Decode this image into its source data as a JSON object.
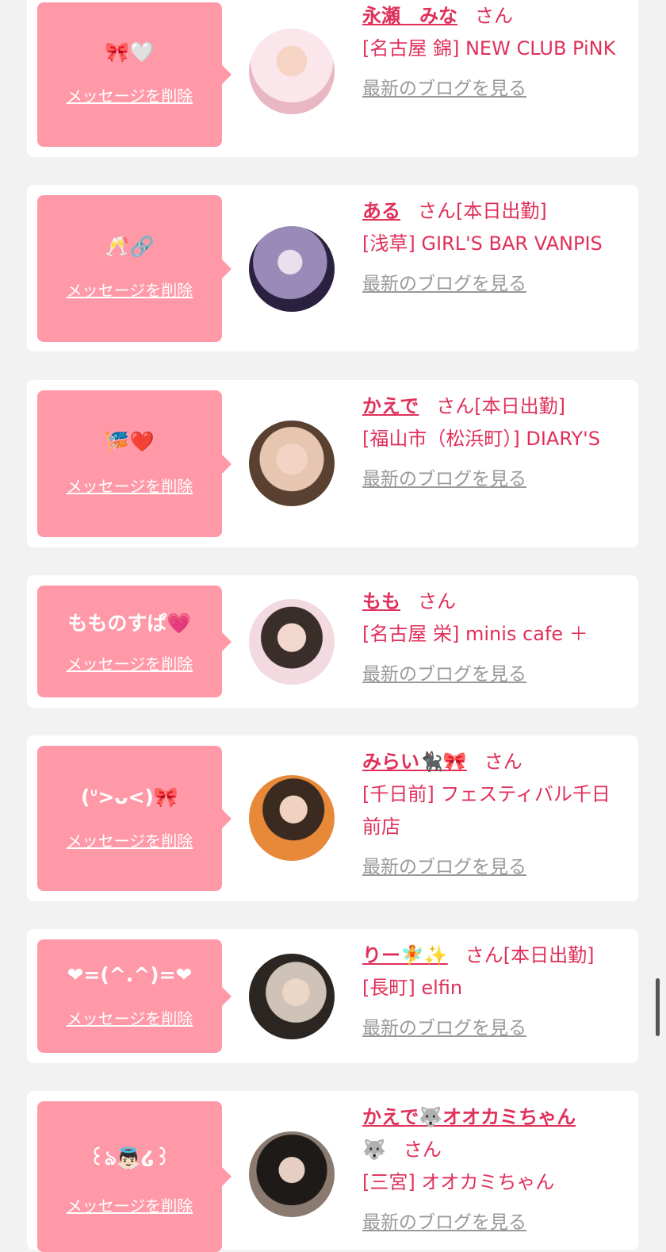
{
  "cards": [
    {
      "message": "🎀🤍",
      "delete_label": "メッセージを削除",
      "name": "永瀬　みな",
      "honorific": "さん",
      "status": "",
      "shop": "[名古屋 錦] NEW CLUB PiNK",
      "blog_link": "最新のブログを見る",
      "avatar_colors": [
        "#fbe6ec",
        "#e8b7c3"
      ]
    },
    {
      "message": "🥂🔗",
      "delete_label": "メッセージを削除",
      "name": "ある",
      "honorific": "さん",
      "status": "[本日出勤]",
      "shop": "[浅草] GIRL'S BAR VANPIS",
      "blog_link": "最新のブログを見る",
      "avatar_colors": [
        "#9a8ab8",
        "#2a2040"
      ]
    },
    {
      "message": "🎏❤️",
      "delete_label": "メッセージを削除",
      "name": "かえで",
      "honorific": "さん",
      "status": "[本日出勤]",
      "shop": "[福山市（松浜町）] DIARY'S",
      "blog_link": "最新のブログを見る",
      "avatar_colors": [
        "#e6c6b0",
        "#5a4030"
      ]
    },
    {
      "message": "もものすぱ💗",
      "delete_label": "メッセージを削除",
      "name": "もも",
      "honorific": "さん",
      "status": "",
      "shop": "[名古屋 栄] minis cafe ＋",
      "blog_link": "最新のブログを見る",
      "avatar_colors": [
        "#f3d9e0",
        "#3a2e2a"
      ]
    },
    {
      "message": "(ᐡ>ᴗ<)🎀",
      "delete_label": "メッセージを削除",
      "name": "みらい🐈‍⬛🎀",
      "honorific": "さん",
      "status": "",
      "shop": "[千日前] フェスティバル千日前店",
      "blog_link": "最新のブログを見る",
      "avatar_colors": [
        "#e8893a",
        "#3a2a20"
      ]
    },
    {
      "message": "❤=(^.^)=❤",
      "delete_label": "メッセージを削除",
      "name": "りー🧚✨",
      "honorific": "さん",
      "status": "[本日出勤]",
      "shop": "[長町] elfin",
      "blog_link": "最新のブログを見る",
      "avatar_colors": [
        "#cfc3b8",
        "#2c2622"
      ]
    },
    {
      "message": "꒰ঌ👼🏻໒꒱",
      "delete_label": "メッセージを削除",
      "name": "かえで🐺オオカミちゃん",
      "name_extra": "🐺",
      "honorific": "さん",
      "status": "",
      "shop": "[三宮] オオカミちゃん",
      "blog_link": "最新のブログを見る",
      "avatar_colors": [
        "#8a7a70",
        "#1e1a18"
      ]
    }
  ]
}
